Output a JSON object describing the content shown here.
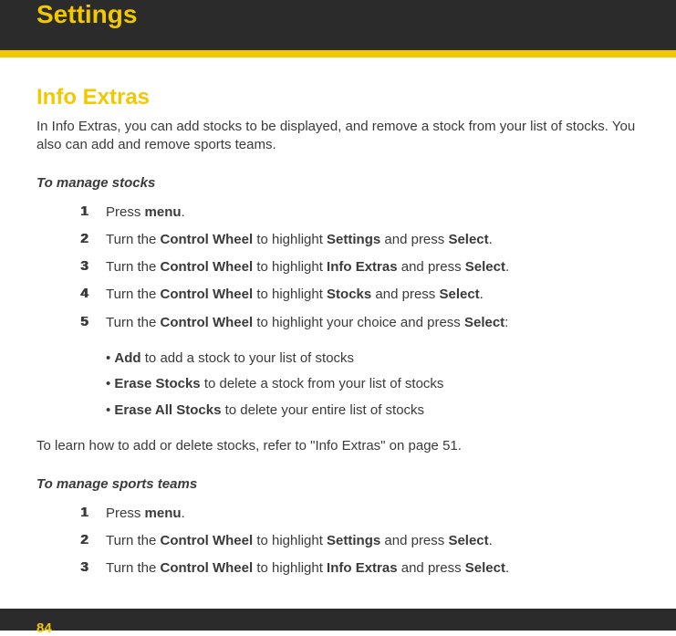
{
  "header": {
    "title": "Settings"
  },
  "section": {
    "title": "Info Extras",
    "intro": "In Info Extras, you can add stocks to be displayed, and remove a stock from your list of stocks. You also can add and remove sports teams."
  },
  "stocks": {
    "heading": "To manage stocks",
    "steps": [
      {
        "num": "1",
        "prefix": "Press ",
        "bold1": "menu",
        "suffix": "."
      },
      {
        "num": "2",
        "prefix": "Turn the ",
        "bold1": "Control Wheel",
        "mid1": " to highlight ",
        "bold2": "Settings",
        "mid2": " and press ",
        "bold3": "Select",
        "suffix": "."
      },
      {
        "num": "3",
        "prefix": "Turn the ",
        "bold1": "Control Wheel",
        "mid1": " to highlight ",
        "bold2": "Info Extras",
        "mid2": " and press ",
        "bold3": "Select",
        "suffix": "."
      },
      {
        "num": "4",
        "prefix": "Turn the ",
        "bold1": "Control Wheel",
        "mid1": " to highlight ",
        "bold2": "Stocks",
        "mid2": " and press ",
        "bold3": "Select",
        "suffix": "."
      },
      {
        "num": "5",
        "prefix": "Turn the ",
        "bold1": "Control Wheel",
        "mid1": " to highlight your choice and press ",
        "bold2": "Select",
        "suffix": ":"
      }
    ],
    "bullets": [
      {
        "bold": "Add",
        "rest": " to add a stock to your list of stocks"
      },
      {
        "bold": "Erase Stocks",
        "rest": " to delete a stock from your list of stocks"
      },
      {
        "bold": "Erase All Stocks",
        "rest": " to delete your entire list of stocks"
      }
    ],
    "footnote": "To learn how to add or delete stocks, refer to \"Info Extras\" on page 51."
  },
  "sports": {
    "heading": "To manage sports teams",
    "steps": [
      {
        "num": "1",
        "prefix": "Press ",
        "bold1": "menu",
        "suffix": "."
      },
      {
        "num": "2",
        "prefix": "Turn the ",
        "bold1": "Control Wheel",
        "mid1": " to highlight ",
        "bold2": "Settings",
        "mid2": " and press ",
        "bold3": "Select",
        "suffix": "."
      },
      {
        "num": "3",
        "prefix": "Turn the ",
        "bold1": "Control Wheel",
        "mid1": " to highlight ",
        "bold2": "Info Extras",
        "mid2": " and press ",
        "bold3": "Select",
        "suffix": "."
      }
    ]
  },
  "page_number": "84"
}
